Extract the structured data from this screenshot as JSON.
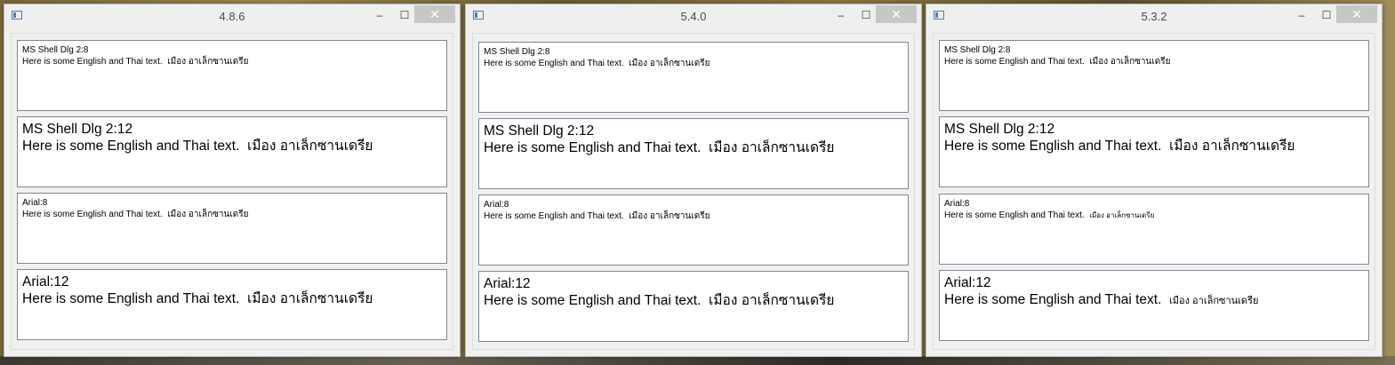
{
  "windows": [
    {
      "title": "4.8.6",
      "panels": [
        {
          "font_label": "MS Shell Dlg 2:8",
          "text_en": "Here is some English and Thai text.",
          "text_th": "เมือง อาเล็กซานเดรีย"
        },
        {
          "font_label": "MS Shell Dlg 2:12",
          "text_en": "Here is some English and Thai text.",
          "text_th": "เมือง อาเล็กซานเดรีย"
        },
        {
          "font_label": "Arial:8",
          "text_en": "Here is some English and Thai text.",
          "text_th": "เมือง อาเล็กซานเดรีย"
        },
        {
          "font_label": "Arial:12",
          "text_en": "Here is some English and Thai text.",
          "text_th": "เมือง อาเล็กซานเดรีย"
        }
      ]
    },
    {
      "title": "5.4.0",
      "panels": [
        {
          "font_label": "MS Shell Dlg 2:8",
          "text_en": "Here is some English and Thai text.",
          "text_th": "เมือง อาเล็กซานเดรีย"
        },
        {
          "font_label": "MS Shell Dlg 2:12",
          "text_en": "Here is some English and Thai text.",
          "text_th": "เมือง อาเล็กซานเดรีย"
        },
        {
          "font_label": "Arial:8",
          "text_en": "Here is some English and Thai text.",
          "text_th": "เมือง อาเล็กซานเดรีย"
        },
        {
          "font_label": "Arial:12",
          "text_en": "Here is some English and Thai text.",
          "text_th": "เมือง อาเล็กซานเดรีย"
        }
      ]
    },
    {
      "title": "5.3.2",
      "panels": [
        {
          "font_label": "MS Shell Dlg 2:8",
          "text_en": "Here is some English and Thai text.",
          "text_th": "เมือง อาเล็กซานเดรีย"
        },
        {
          "font_label": "MS Shell Dlg 2:12",
          "text_en": "Here is some English and Thai text.",
          "text_th": "เมือง อาเล็กซานเดรีย"
        },
        {
          "font_label": "Arial:8",
          "text_en": "Here is some English and Thai text.",
          "text_th": "เมือง อาเล็กซานเดรีย"
        },
        {
          "font_label": "Arial:12",
          "text_en": "Here is some English and Thai text.",
          "text_th": "เมือง อาเล็กซานเดรีย"
        }
      ]
    }
  ],
  "controls": {
    "minimize": "–",
    "maximize": "☐",
    "close": "✕"
  }
}
